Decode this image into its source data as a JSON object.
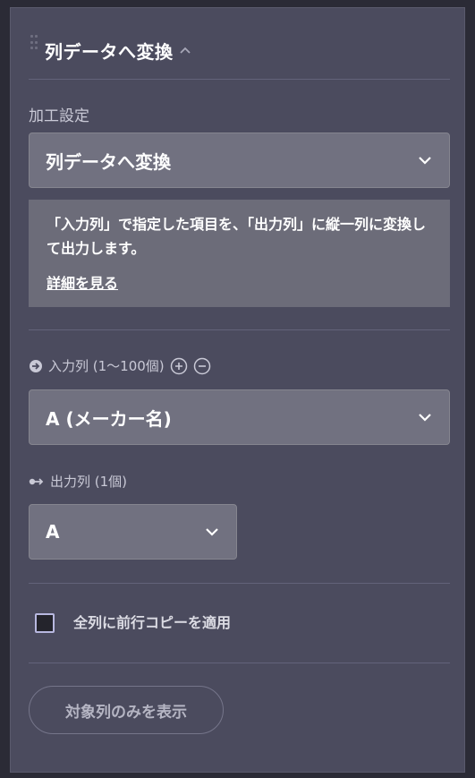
{
  "panel": {
    "title": "列データへ変換",
    "processing_label": "加工設定",
    "processing_value": "列データへ変換",
    "note_text": "「入力列」で指定した項目を、「出力列」に縦一列に変換して出力します。",
    "note_link": "詳細を見る",
    "input_label": "入力列 (1〜100個)",
    "input_value": "A (メーカー名)",
    "output_label": "出力列 (1個)",
    "output_value": "A",
    "checkbox_label": "全列に前行コピーを適用",
    "checkbox_checked": false,
    "show_button": "対象列のみを表示"
  },
  "colors": {
    "panel_bg": "#4b4b5e",
    "select_bg": "#717180",
    "note_bg": "#6c6c79",
    "page_bg": "#2b2b36"
  },
  "icons": {
    "drag_handle": "drag-handle-icon",
    "collapse": "chevron-up-icon",
    "dropdown": "chevron-down-icon",
    "input_marker": "arrow-circle-right-icon",
    "add": "plus-circle-icon",
    "remove": "minus-circle-icon",
    "output_marker": "arrow-right-icon"
  }
}
